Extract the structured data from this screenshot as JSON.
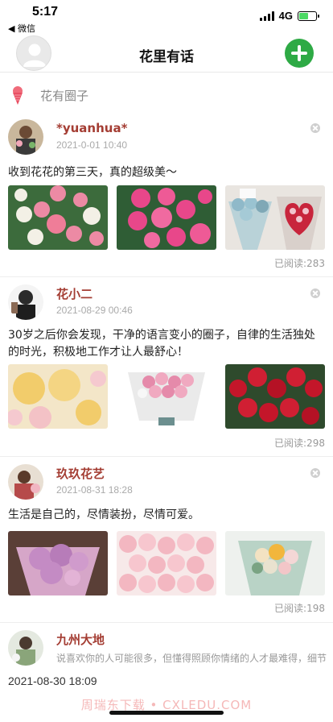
{
  "status_bar": {
    "time": "5:17",
    "back_label": "◀ 微信",
    "network": "4G",
    "battery_level": 0.6
  },
  "header": {
    "title": "花里有话",
    "avatar_icon": "user-avatar-placeholder-icon",
    "add_icon": "plus-circle-icon",
    "accent_color": "#2eaa45"
  },
  "section": {
    "label": "花有圈子",
    "icon": "ice-cream-cone-icon"
  },
  "posts": [
    {
      "name": "*yuanhua*",
      "time": "2021-0-01 10:40",
      "text": "收到花花的第三天，真的超级美～",
      "read": "已阅读:283",
      "images": [
        "white-and-pink-roses",
        "pink-roses-bouquet",
        "blue-and-red-heart-bouquets"
      ]
    },
    {
      "name": "花小二",
      "time": "2021-08-29 00:46",
      "text": "30岁之后你会发现，干净的语言变小的圈子，自律的生活独处的时光，积极地工作才让人最舒心！",
      "read": "已阅读:298",
      "images": [
        "yellow-and-pink-roses",
        "pink-carnation-bouquet",
        "red-roses"
      ]
    },
    {
      "name": "玖玖花艺",
      "time": "2021-08-31 18:28",
      "text": "生活是自己的，尽情装扮，尽情可爱。",
      "read": "已阅读:198",
      "images": [
        "purple-hydrangea-bouquet",
        "light-pink-roses",
        "mixed-flower-bouquet"
      ]
    }
  ],
  "preview_post": {
    "name": "九州大地",
    "text": "说喜欢你的人可能很多，但懂得照顾你情绪的人才最难得，细节",
    "time": "2021-08-30 18:09"
  },
  "watermark": "周瑞东下载 • CXLEDU.COM",
  "name_color": "#a43d33"
}
